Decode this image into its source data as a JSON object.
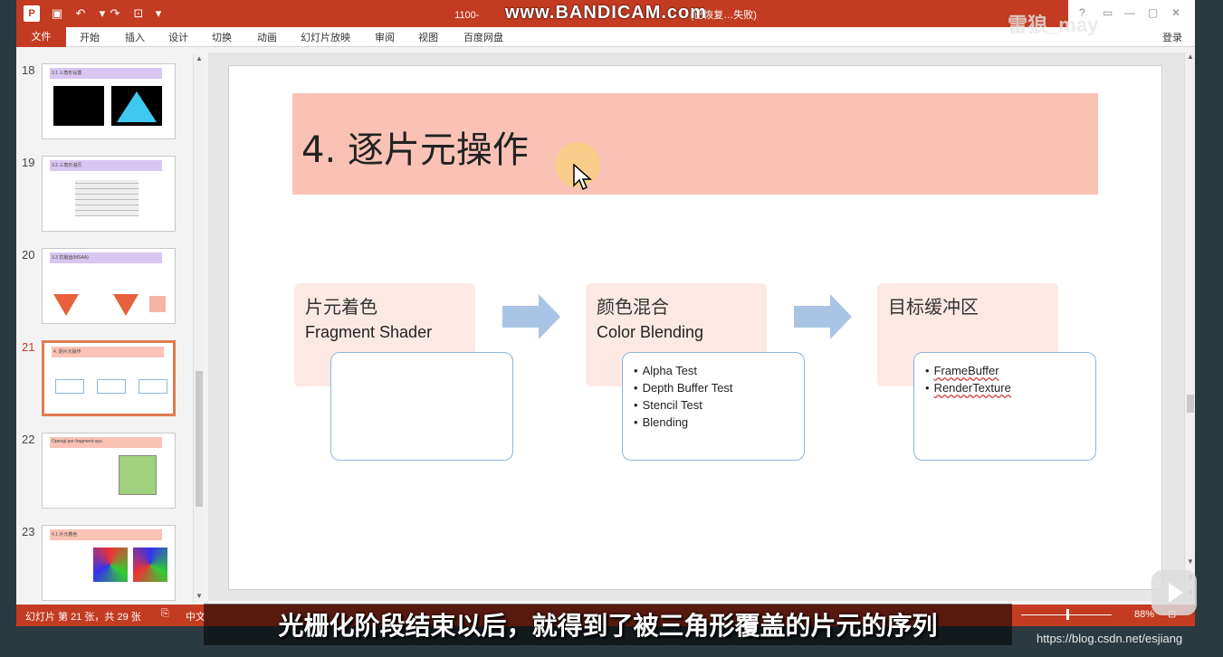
{
  "titlebar": {
    "title": "1100-",
    "title_suffix": "(已恢复…失败)",
    "recorder_watermark": "www.BANDICAM.com",
    "streamer_watermark": "雷狼_may",
    "controls": [
      "?",
      "▭",
      "—",
      "▢",
      "✕"
    ]
  },
  "ribbon": {
    "file_tab": "文件",
    "tabs": [
      "开始",
      "插入",
      "设计",
      "切换",
      "动画",
      "幻灯片放映",
      "审阅",
      "视图",
      "百度网盘"
    ],
    "sign_in": "登录"
  },
  "thumbnails": [
    {
      "num": "18",
      "heading": "3.1 三角形设置"
    },
    {
      "num": "19",
      "heading": "3.2 三角形遍历"
    },
    {
      "num": "20",
      "heading": "3.3 抗锯齿(MSAA)"
    },
    {
      "num": "21",
      "heading": "4. 逐片元操作",
      "selected": true
    },
    {
      "num": "22",
      "heading": "Opengl per-fragment ops"
    },
    {
      "num": "23",
      "heading": "4.1 片元着色"
    }
  ],
  "slide": {
    "title": "4. 逐片元操作",
    "stages": [
      {
        "cn": "片元着色",
        "en": "Fragment Shader",
        "items": []
      },
      {
        "cn": "颜色混合",
        "en": "Color Blending",
        "items": [
          "Alpha Test",
          "Depth Buffer Test",
          "Stencil Test",
          "Blending"
        ]
      },
      {
        "cn": "目标缓冲区",
        "en": "",
        "items": [
          "FrameBuffer",
          "RenderTexture"
        ]
      }
    ]
  },
  "status": {
    "slide_info": "幻灯片 第 21 张，共 29 张",
    "language": "中文",
    "zoom": "88%"
  },
  "subtitle": "光栅化阶段结束以后，就得到了被三角形覆盖的片元的序列",
  "url_watermark": "https://blog.csdn.net/esjiang",
  "colors": {
    "accent": "#c33b22",
    "title_fill": "#f9c2b5",
    "stage_fill": "#fde9e4",
    "arrow_fill": "#a9c4e4",
    "detail_border": "#8fb5d9"
  }
}
